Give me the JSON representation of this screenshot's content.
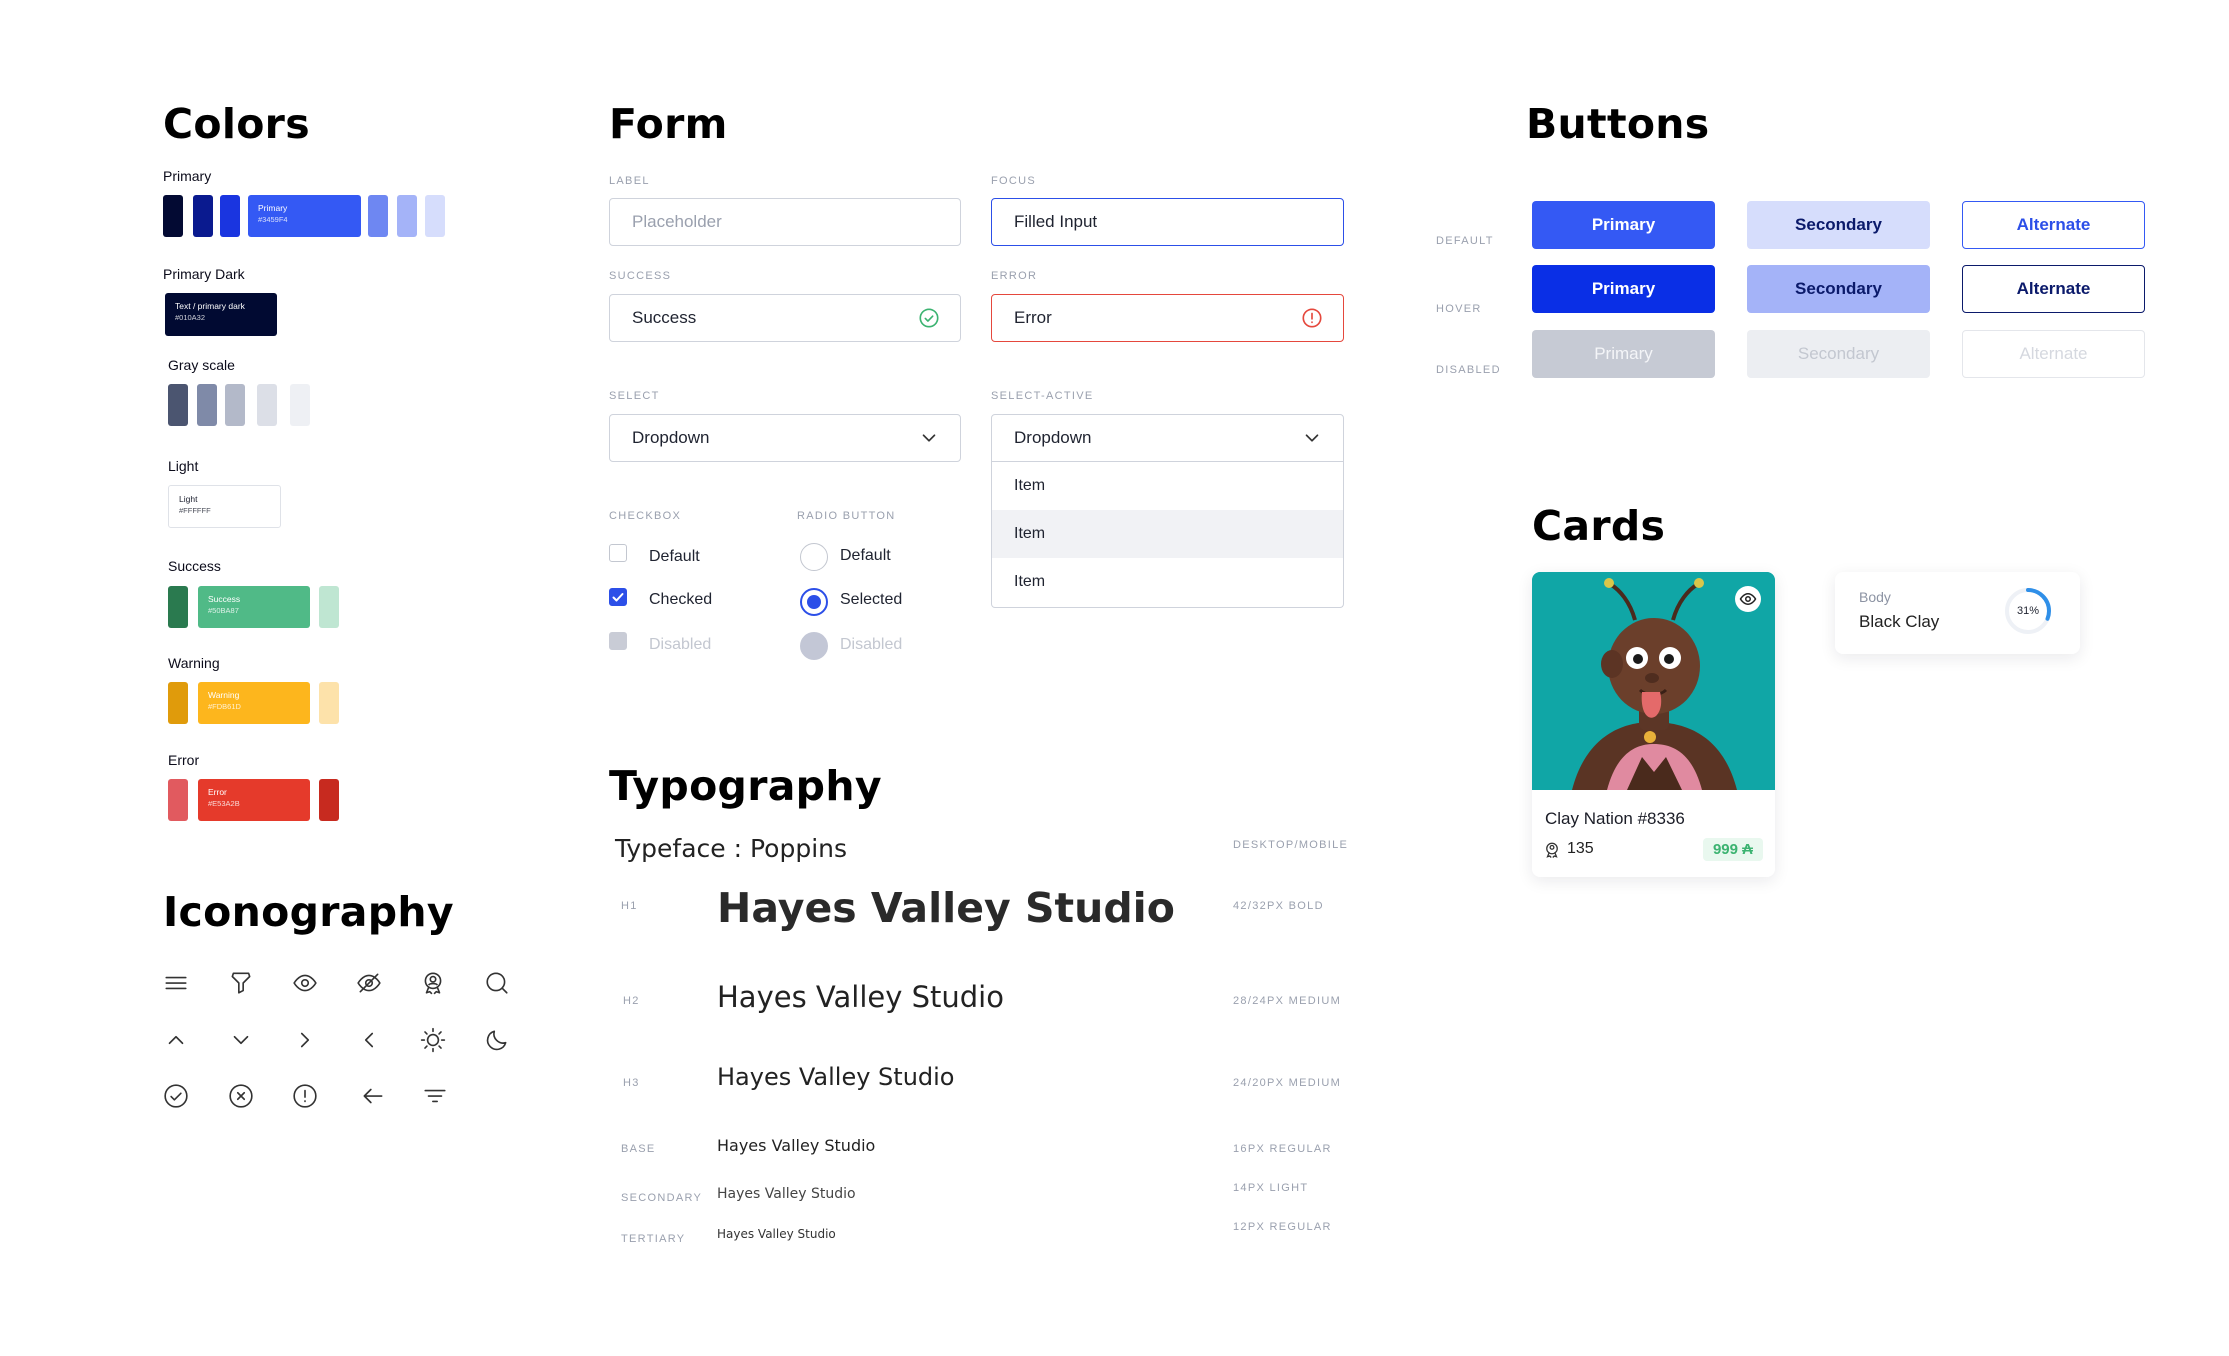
{
  "colors": {
    "title": "Colors",
    "primary": {
      "label": "Primary",
      "swatch_text": "Primary",
      "swatch_hex": "#3459F4"
    },
    "primary_dark": {
      "label": "Primary Dark",
      "swatch_text": "Text / primary dark",
      "swatch_hex": "#010A32"
    },
    "gray": {
      "label": "Gray scale"
    },
    "light": {
      "label": "Light",
      "swatch_text": "Light",
      "swatch_hex": "#FFFFFF"
    },
    "success": {
      "label": "Success",
      "swatch_text": "Success",
      "swatch_hex": "#50BA87"
    },
    "warning": {
      "label": "Warning",
      "swatch_text": "Warning",
      "swatch_hex": "#FDB61D"
    },
    "error": {
      "label": "Error",
      "swatch_text": "Error",
      "swatch_hex": "#E53A2B"
    },
    "palette": {
      "primary": [
        "#030a33",
        "#0a1a8f",
        "#1a35e0",
        "#3459F4",
        "#6e87f2",
        "#a4b3f8",
        "#d6ddfc"
      ],
      "gray": [
        "#4b5570",
        "#7f8aa8",
        "#b3b9c9",
        "#dcdfe7",
        "#eef0f4"
      ],
      "success": [
        "#2a7a4f",
        "#50BA87",
        "#bfe6d2"
      ],
      "warning": [
        "#e09b0b",
        "#FDB61D",
        "#fde2aa"
      ],
      "error": [
        "#e15a5f",
        "#E53A2B",
        "#c72a1f"
      ]
    }
  },
  "form": {
    "title": "Form",
    "label_field": {
      "label": "LABEL",
      "placeholder": "Placeholder"
    },
    "focus_field": {
      "label": "FOCUS",
      "value": "Filled Input"
    },
    "success_field": {
      "label": "SUCCESS",
      "value": "Success"
    },
    "error_field": {
      "label": "ERROR",
      "value": "Error"
    },
    "select": {
      "label": "SELECT",
      "value": "Dropdown"
    },
    "select_active": {
      "label": "SELECT-ACTIVE",
      "value": "Dropdown",
      "items": [
        "Item",
        "Item",
        "Item"
      ]
    },
    "checkbox": {
      "label": "CHECKBOX",
      "default": "Default",
      "checked": "Checked",
      "disabled": "Disabled"
    },
    "radio": {
      "label": "RADIO BUTTON",
      "default": "Default",
      "selected": "Selected",
      "disabled": "Disabled"
    }
  },
  "buttons": {
    "title": "Buttons",
    "row_labels": {
      "default": "DEFAULT",
      "hover": "HOVER",
      "disabled": "DISABLED"
    },
    "primary_label": "Primary",
    "secondary_label": "Secondary",
    "alternate_label": "Alternate"
  },
  "cards": {
    "title": "Cards",
    "nft": {
      "name": "Clay Nation #8336",
      "count": "135",
      "price": "999 ₳"
    },
    "stat": {
      "label": "Body",
      "value": "Black Clay",
      "percent_text": "31%",
      "percent": 0.31
    }
  },
  "iconography": {
    "title": "Iconography",
    "icons": [
      "menu-icon",
      "filter-funnel-icon",
      "eye-icon",
      "eye-off-icon",
      "user-badge-icon",
      "search-icon",
      "chevron-up-icon",
      "chevron-down-icon",
      "chevron-right-icon",
      "chevron-left-icon",
      "sun-icon",
      "moon-icon",
      "check-circle-icon",
      "x-circle-icon",
      "alert-circle-icon",
      "arrow-left-icon",
      "filter-lines-icon"
    ]
  },
  "typography": {
    "title": "Typography",
    "typeface": "Typeface : Poppins",
    "column_header": "DESKTOP/MOBILE",
    "sample": "Hayes Valley Studio",
    "rows": [
      {
        "tag": "H1",
        "spec": "42/32PX BOLD"
      },
      {
        "tag": "H2",
        "spec": "28/24PX MEDIUM"
      },
      {
        "tag": "H3",
        "spec": "24/20PX MEDIUM"
      },
      {
        "tag": "BASE",
        "spec": "16PX REGULAR"
      },
      {
        "tag": "SECONDARY",
        "spec": "14PX LIGHT"
      },
      {
        "tag": "TERTIARY",
        "spec": "12PX REGULAR"
      }
    ]
  }
}
